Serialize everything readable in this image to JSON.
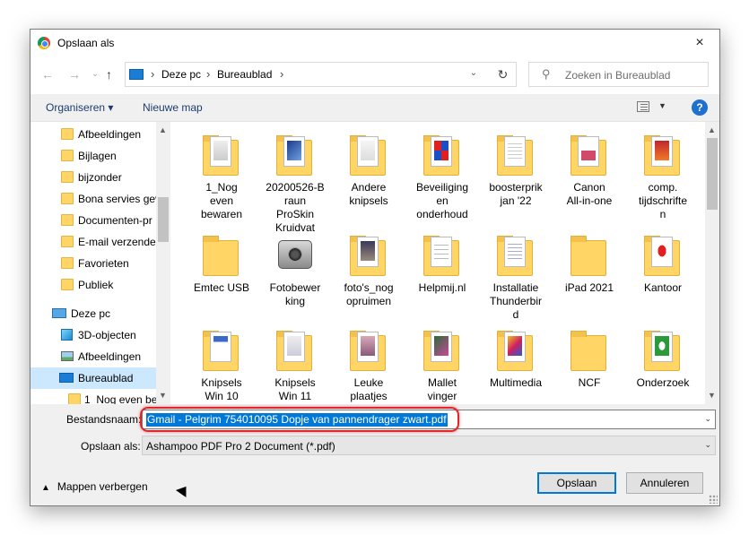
{
  "window": {
    "title": "Opslaan als",
    "close_icon": "×"
  },
  "navigation": {
    "back_icon": "←",
    "forward_icon": "→",
    "recent_icon": "⌄",
    "up_icon": "↑",
    "breadcrumb": [
      "Deze pc",
      "Bureaublad"
    ],
    "breadcrumb_sep": "›",
    "dropdown_icon": "⌄",
    "refresh_icon": "↻",
    "search_icon": "⚲",
    "search_placeholder": "Zoeken in Bureaublad"
  },
  "toolbar": {
    "organize_label": "Organiseren ▾",
    "new_folder_label": "Nieuwe map",
    "view_dropdown": "▼",
    "help_label": "?"
  },
  "sidebar": {
    "scroll_up": "▲",
    "scroll_down": "▼",
    "items": [
      {
        "label": "Afbeeldingen"
      },
      {
        "label": "Bijlagen"
      },
      {
        "label": "bijzonder"
      },
      {
        "label": "Bona servies gev"
      },
      {
        "label": "Documenten-pr"
      },
      {
        "label": "E-mail verzender"
      },
      {
        "label": "Favorieten"
      },
      {
        "label": "Publiek"
      },
      {
        "label": "Deze pc"
      },
      {
        "label": "3D-objecten"
      },
      {
        "label": "Afbeeldingen"
      },
      {
        "label": "Bureaublad"
      },
      {
        "label": "1_Nog even be"
      }
    ]
  },
  "files": {
    "scroll_up": "▲",
    "scroll_down": "▼",
    "items": [
      {
        "label": "1_Nog\neven\nbewaren"
      },
      {
        "label": "20200526-B\nraun\nProSkin\nKruidvat"
      },
      {
        "label": "Andere\nknipsels"
      },
      {
        "label": "Beveiliging\nen\nonderhoud"
      },
      {
        "label": "boosterprik\njan '22"
      },
      {
        "label": "Canon\nAll-in-one"
      },
      {
        "label": "comp.\ntijdschrifte\nn"
      },
      {
        "label": "Emtec USB"
      },
      {
        "label": "Fotobewer\nking"
      },
      {
        "label": "foto's_nog\nopruimen"
      },
      {
        "label": "Helpmij.nl"
      },
      {
        "label": "Installatie\nThunderbir\nd"
      },
      {
        "label": "iPad 2021"
      },
      {
        "label": "Kantoor"
      },
      {
        "label": "Knipsels\nWin 10"
      },
      {
        "label": "Knipsels\nWin 11"
      },
      {
        "label": "Leuke\nplaatjes"
      },
      {
        "label": "Mallet\nvinger"
      },
      {
        "label": "Multimedia"
      },
      {
        "label": "NCF"
      },
      {
        "label": "Onderzoek"
      }
    ]
  },
  "form": {
    "filename_label": "Bestandsnaam:",
    "filename_value": "Gmail - Pelgrim 754010095 Dopje van pannendrager zwart.pdf",
    "filename_dropdown": "⌄",
    "filetype_label": "Opslaan als:",
    "filetype_value": "Ashampoo PDF Pro 2 Document (*.pdf)",
    "filetype_dropdown": "⌄",
    "hide_folders_label": "Mappen verbergen",
    "hide_folders_chevron": "▲",
    "save_label": "Opslaan",
    "cancel_label": "Annuleren"
  },
  "colors": {
    "selection": "#0078d7",
    "highlight_oval": "#e0262b",
    "nav_selected": "#cce8ff"
  }
}
